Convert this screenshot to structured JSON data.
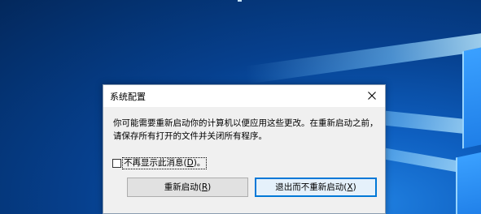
{
  "dialog": {
    "title": "系统配置",
    "message": "你可能需要重新启动你的计算机以便应用这些更改。在重新启动之前，请保存所有打开的文件并关闭所有程序。",
    "checkbox": {
      "label_pre": "不再显示此消息(",
      "label_key": "D",
      "label_post": ")。",
      "checked": false
    },
    "buttons": {
      "restart": {
        "pre": "重新启动(",
        "key": "R",
        "post": ")"
      },
      "exit": {
        "pre": "退出而不重新启动(",
        "key": "X",
        "post": ")"
      }
    }
  },
  "colors": {
    "accent": "#0078d7",
    "desktop_dark": "#03285c",
    "desktop_light": "#1f7fe0",
    "dialog_bg": "#f0f0f0"
  },
  "icons": {
    "close": "close-icon"
  }
}
